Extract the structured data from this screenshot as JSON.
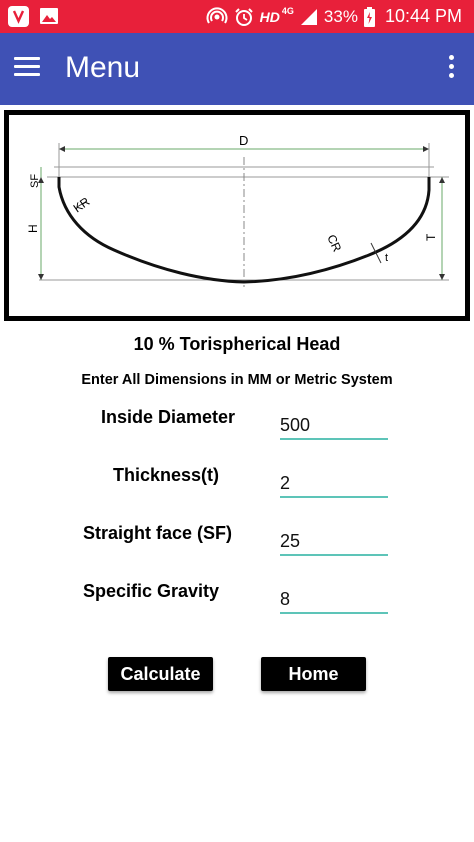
{
  "status_bar": {
    "battery": "33%",
    "time": "10:44 PM",
    "network_hd": "HD",
    "network_type": "4G"
  },
  "app_bar": {
    "title": "Menu"
  },
  "diagram": {
    "label_D": "D",
    "label_SF": "SF",
    "label_KR": "KR",
    "label_H": "H",
    "label_CR": "CR",
    "label_t": "t",
    "label_T": "T"
  },
  "heading": "10 % Torispherical Head",
  "instruction": "Enter All Dimensions in MM or Metric System",
  "fields": [
    {
      "label": "Inside Diameter",
      "value": "500"
    },
    {
      "label": "Thickness(t)",
      "value": "2"
    },
    {
      "label": "Straight face (SF)",
      "value": "25"
    },
    {
      "label": "Specific Gravity",
      "value": "8"
    }
  ],
  "buttons": {
    "calculate": "Calculate",
    "home": "Home"
  },
  "colors": {
    "status_bar": "#e8203a",
    "app_bar": "#3f51b5",
    "input_underline": "#5dc4b8"
  }
}
